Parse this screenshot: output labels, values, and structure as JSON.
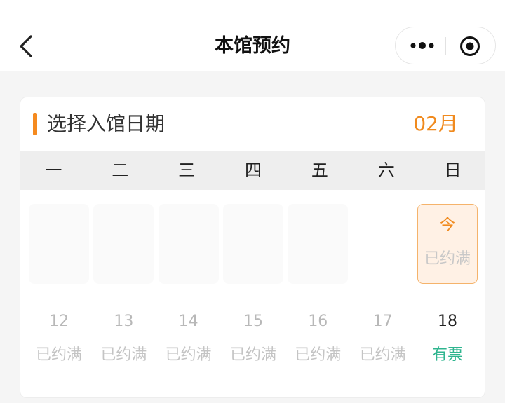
{
  "navbar": {
    "title": "本馆预约",
    "back_icon": "chevron-left-icon",
    "more_icon": "more-dots-icon",
    "close_icon": "target-circle-icon"
  },
  "card": {
    "title": "选择入馆日期",
    "month": "02月",
    "accent_color": "#f58a1f"
  },
  "weekdays": [
    "一",
    "二",
    "三",
    "四",
    "五",
    "六",
    "日"
  ],
  "rows": [
    [
      {
        "type": "blank"
      },
      {
        "type": "blank"
      },
      {
        "type": "blank"
      },
      {
        "type": "blank"
      },
      {
        "type": "blank"
      },
      {
        "type": "empty"
      },
      {
        "type": "today",
        "day": "今",
        "status": "已约满"
      }
    ],
    [
      {
        "type": "full",
        "day": "12",
        "status": "已约满"
      },
      {
        "type": "full",
        "day": "13",
        "status": "已约满"
      },
      {
        "type": "full",
        "day": "14",
        "status": "已约满"
      },
      {
        "type": "full",
        "day": "15",
        "status": "已约满"
      },
      {
        "type": "full",
        "day": "16",
        "status": "已约满"
      },
      {
        "type": "full",
        "day": "17",
        "status": "已约满"
      },
      {
        "type": "avail",
        "day": "18",
        "status": "有票"
      }
    ]
  ],
  "colors": {
    "today": "#f08a1e",
    "available": "#2fb58f",
    "full": "#c4c4c4"
  }
}
